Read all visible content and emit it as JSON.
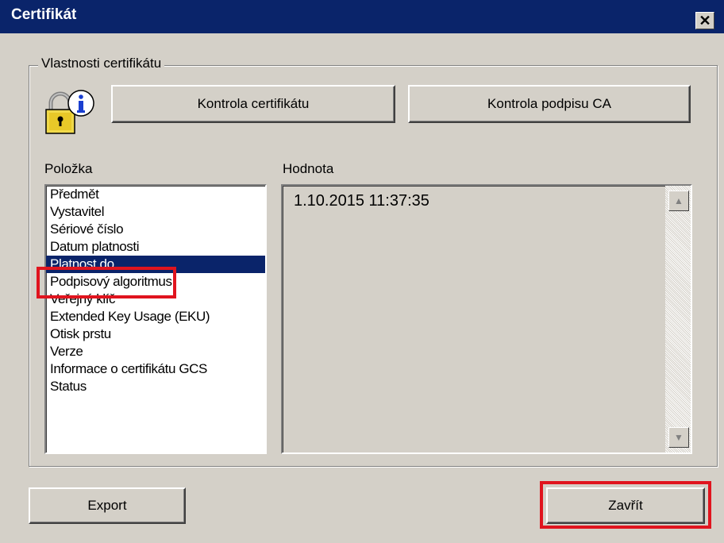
{
  "window": {
    "title": "Certifikát",
    "close_glyph": "✕"
  },
  "group": {
    "legend": "Vlastnosti certifikátu",
    "icon": "certificate-lock-info-icon",
    "buttons": {
      "check_certificate": "Kontrola certifikátu",
      "check_ca_signature": "Kontrola podpisu CA"
    }
  },
  "item_list": {
    "header": "Položka",
    "items": [
      "Předmět",
      "Vystavitel",
      "Sériové číslo",
      "Datum platnosti",
      "Platnost do",
      "Podpisový algoritmus",
      "Veřejný klíč",
      "Extended Key Usage (EKU)",
      "Otisk prstu",
      "Verze",
      "Informace o certifikátu GCS",
      "Status"
    ],
    "selected_index": 4
  },
  "value_panel": {
    "header": "Hodnota",
    "value": "1.10.2015 11:37:35"
  },
  "footer": {
    "export_label": "Export",
    "close_label": "Zavřít"
  },
  "colors": {
    "titlebar": "#0a246a",
    "dialog_face": "#d4d0c8",
    "selection": "#0a246a",
    "highlight_box": "#e0141e"
  }
}
